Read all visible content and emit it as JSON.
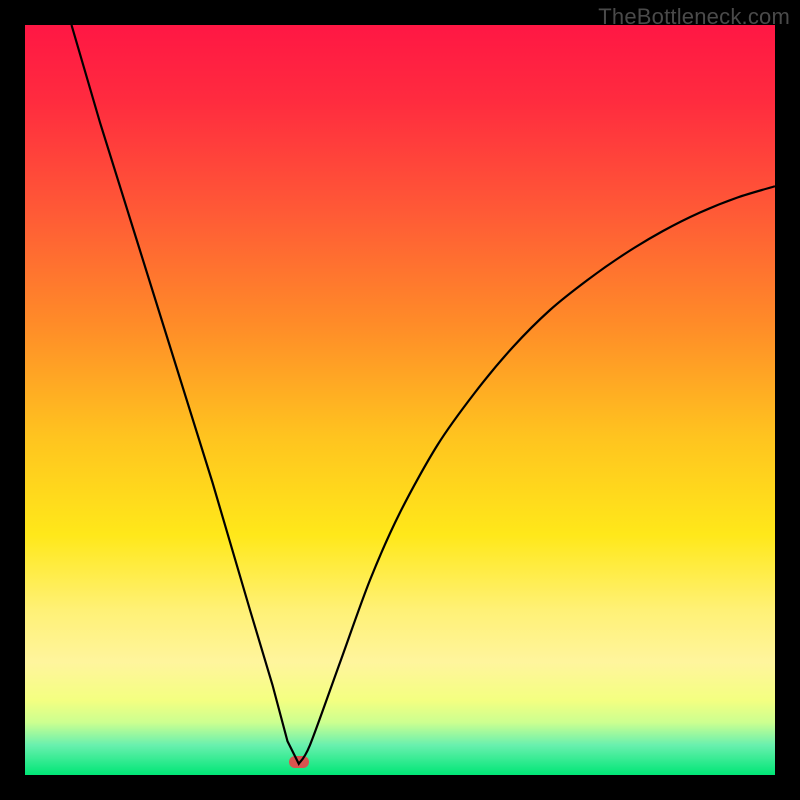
{
  "watermark": "TheBottleneck.com",
  "colors": {
    "background": "#000000",
    "curve": "#000000",
    "marker": "#d9534f",
    "gradient_top": "#ff1744",
    "gradient_bottom": "#00e676"
  },
  "chart_data": {
    "type": "line",
    "title": "",
    "xlabel": "",
    "ylabel": "",
    "xlim": [
      0,
      100
    ],
    "ylim": [
      0,
      100
    ],
    "grid": false,
    "legend": false,
    "note": "Bottleneck-style V curve. x is relative horizontal position (percent of plot width), y is relative height (percent of plot height, 0 at bottom). Minimum at the marker position.",
    "series": [
      {
        "name": "bottleneck-curve",
        "x": [
          6.2,
          10,
          15,
          20,
          25,
          30,
          33,
          35,
          36.5,
          38,
          42,
          46,
          50,
          55,
          60,
          65,
          70,
          75,
          80,
          85,
          90,
          95,
          100
        ],
        "y": [
          100,
          87,
          71,
          55,
          39,
          22,
          12,
          4.5,
          1.5,
          4,
          15,
          26,
          35,
          44,
          51,
          57,
          62,
          66,
          69.5,
          72.5,
          75,
          77,
          78.5
        ]
      }
    ],
    "marker": {
      "x": 36.5,
      "y": 1.7
    }
  }
}
